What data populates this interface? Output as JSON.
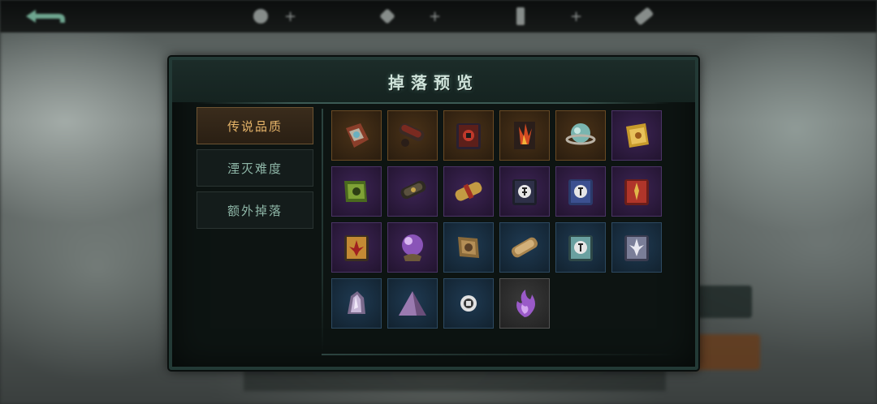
{
  "top_bar": {
    "title": "",
    "resources": [
      {
        "icon": "coin-icon",
        "value": ""
      },
      {
        "icon": "gem-icon",
        "value": ""
      },
      {
        "icon": "energy-icon",
        "value": ""
      },
      {
        "icon": "ticket-icon",
        "value": ""
      }
    ]
  },
  "panel": {
    "title": "掉落预览",
    "tabs": [
      {
        "label": "传说品质",
        "active": true
      },
      {
        "label": "湮灭难度",
        "active": false
      },
      {
        "label": "额外掉落",
        "active": false
      }
    ],
    "items": [
      {
        "name": "bag-icon",
        "rarity": "orange"
      },
      {
        "name": "cannon-icon",
        "rarity": "orange"
      },
      {
        "name": "red-tome-icon",
        "rarity": "orange"
      },
      {
        "name": "flame-banner-icon",
        "rarity": "orange"
      },
      {
        "name": "orb-ring-icon",
        "rarity": "orange"
      },
      {
        "name": "gold-scroll-icon",
        "rarity": "purple"
      },
      {
        "name": "green-scroll-icon",
        "rarity": "purple"
      },
      {
        "name": "dark-scroll-icon",
        "rarity": "purple"
      },
      {
        "name": "sealed-scroll-icon",
        "rarity": "purple"
      },
      {
        "name": "rune-book-icon",
        "rarity": "purple"
      },
      {
        "name": "rune-book-2-icon",
        "rarity": "purple"
      },
      {
        "name": "red-book-icon",
        "rarity": "purple"
      },
      {
        "name": "fleur-book-icon",
        "rarity": "purple"
      },
      {
        "name": "crystal-ball-icon",
        "rarity": "purple"
      },
      {
        "name": "map-scroll-icon",
        "rarity": "blue"
      },
      {
        "name": "rolled-scroll-icon",
        "rarity": "blue"
      },
      {
        "name": "teal-book-icon",
        "rarity": "blue"
      },
      {
        "name": "lily-book-icon",
        "rarity": "blue"
      },
      {
        "name": "crystal-shard-icon",
        "rarity": "blue"
      },
      {
        "name": "pyramid-icon",
        "rarity": "blue"
      },
      {
        "name": "coin-token-icon",
        "rarity": "blue"
      },
      {
        "name": "purple-flame-icon",
        "rarity": "gray"
      }
    ]
  },
  "colors": {
    "tab_active_text": "#e7b56a",
    "tab_text": "#8fb7a8",
    "title_text": "#cfe3da",
    "panel_border": "#233a36"
  }
}
